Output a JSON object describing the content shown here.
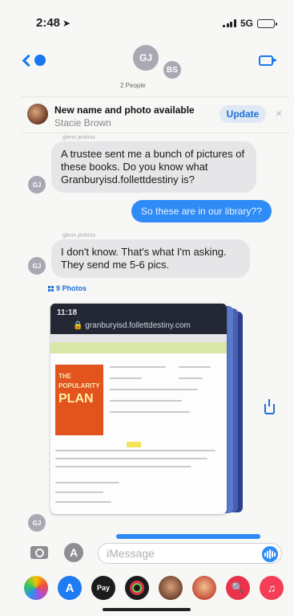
{
  "status_bar": {
    "time": "2:48",
    "network": "5G"
  },
  "header": {
    "avatars": [
      {
        "initials": "GJ"
      },
      {
        "initials": "BS"
      }
    ],
    "people_count": "2 People"
  },
  "banner": {
    "title": "New name and photo available",
    "name": "Stacie Brown",
    "update_label": "Update",
    "dismiss": "×"
  },
  "messages": [
    {
      "sender": "glenn jenkins",
      "text": "A trustee sent me a bunch of pictures of these books. Do you know what Granburyisd.follettdestiny is?",
      "initials": "GJ"
    },
    {
      "outgoing": true,
      "text": "So these are in our library??"
    },
    {
      "sender": "glenn jenkins",
      "text": "I don't know. That's what I'm asking. They send me 5-6 pics.",
      "initials": "GJ"
    }
  ],
  "photos": {
    "label": "9 Photos",
    "screenshot": {
      "time": "11:18",
      "url": "granburyisd.follettdestiny.com",
      "book_title_1": "THE",
      "book_title_2": "POPULARITY",
      "book_title_3": "PLAN"
    },
    "sender_initials": "GJ"
  },
  "composer": {
    "placeholder": "iMessage"
  },
  "app_drawer": {
    "apps": [
      {
        "name": "photos",
        "color": "#f0f0f0"
      },
      {
        "name": "app-store",
        "color": "#1f7bf2"
      },
      {
        "name": "apple-pay",
        "label": "Pay",
        "color": "#1c1c1e"
      },
      {
        "name": "activity",
        "color": "#1c1c1e"
      },
      {
        "name": "memoji",
        "color": "#d8b08a"
      },
      {
        "name": "memoji-2",
        "color": "#c7503c"
      },
      {
        "name": "search-images",
        "color": "#e8334a"
      },
      {
        "name": "music",
        "color": "#f53d55"
      }
    ]
  },
  "colors": {
    "accent": "#1877f2",
    "outgoing_bubble": "#2f8cf6",
    "incoming_bubble": "#e6e6e8"
  }
}
